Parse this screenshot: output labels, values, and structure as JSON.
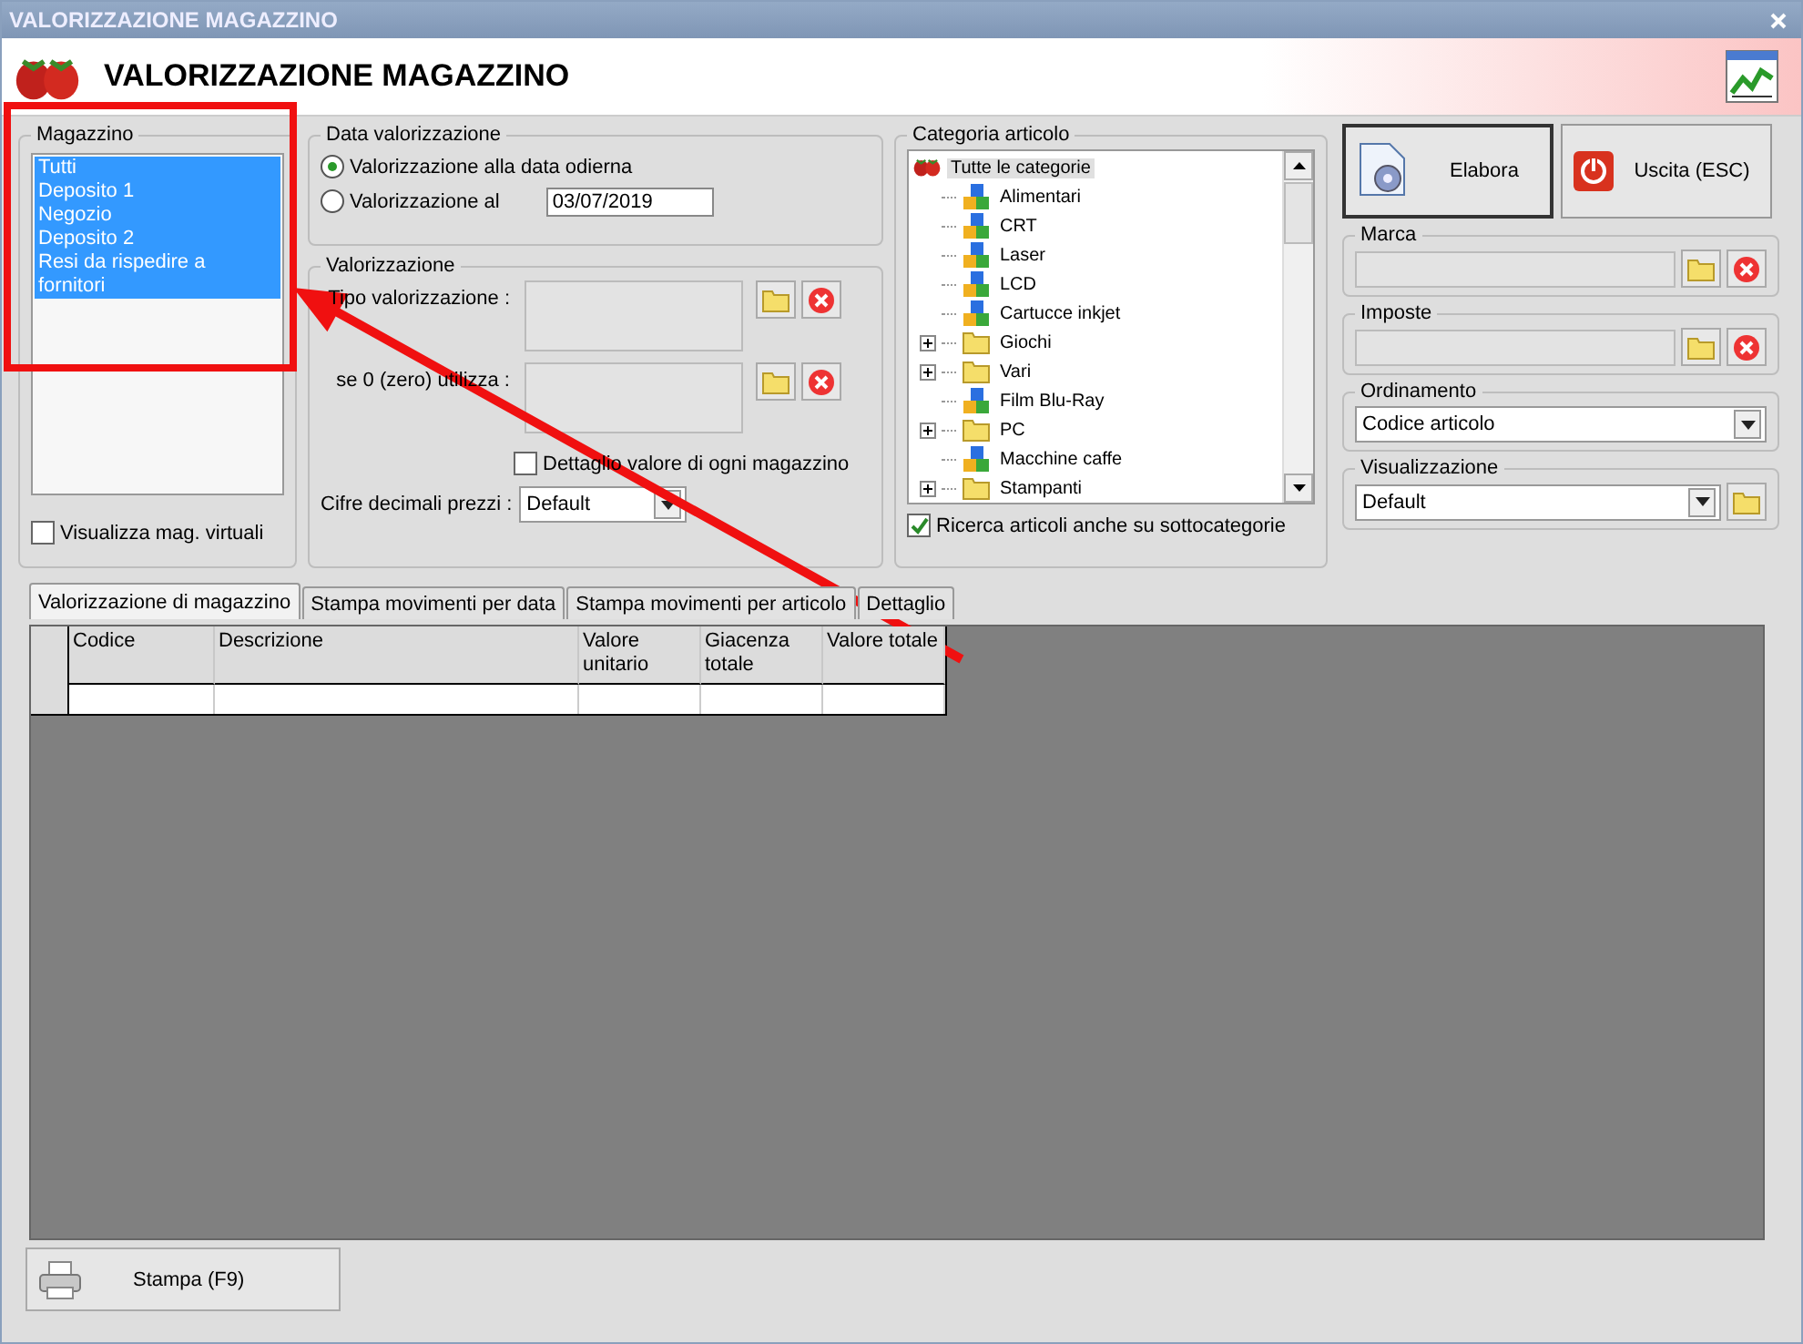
{
  "window": {
    "title": "VALORIZZAZIONE MAGAZZINO"
  },
  "header": {
    "title": "VALORIZZAZIONE MAGAZZINO"
  },
  "magazzino": {
    "label": "Magazzino",
    "items": [
      {
        "label": "Tutti",
        "selected": true
      },
      {
        "label": "Deposito 1",
        "selected": true
      },
      {
        "label": "Negozio",
        "selected": true
      },
      {
        "label": "Deposito 2",
        "selected": true
      },
      {
        "label": "Resi da rispedire a fornitori",
        "selected": true
      }
    ],
    "virtual": {
      "label": "Visualizza mag. virtuali",
      "checked": false
    }
  },
  "data_valorizzazione": {
    "label": "Data valorizzazione",
    "options": [
      {
        "label": "Valorizzazione alla data odierna",
        "selected": true
      },
      {
        "label": "Valorizzazione al",
        "selected": false
      }
    ],
    "date": "03/07/2019"
  },
  "valorizzazione": {
    "label": "Valorizzazione",
    "tipo_label": "Tipo valorizzazione :",
    "zero_label": "se 0 (zero) utilizza :",
    "dettaglio": {
      "label": "Dettaglio valore di ogni magazzino",
      "checked": false
    },
    "decimali_label": "Cifre decimali prezzi :",
    "decimali_value": "Default"
  },
  "categoria": {
    "label": "Categoria articolo",
    "root": {
      "label": "Tutte le categorie",
      "selected": true,
      "children": [
        {
          "label": "Alimentari",
          "kind": "category",
          "expandable": false
        },
        {
          "label": "CRT",
          "kind": "category",
          "expandable": false
        },
        {
          "label": "Laser",
          "kind": "category",
          "expandable": false
        },
        {
          "label": "LCD",
          "kind": "category",
          "expandable": false
        },
        {
          "label": "Cartucce inkjet",
          "kind": "category",
          "expandable": false
        },
        {
          "label": "Giochi",
          "kind": "folder",
          "expandable": true
        },
        {
          "label": "Vari",
          "kind": "folder",
          "expandable": true
        },
        {
          "label": "Film Blu-Ray",
          "kind": "category",
          "expandable": false
        },
        {
          "label": "PC",
          "kind": "folder",
          "expandable": true
        },
        {
          "label": "Macchine caffe",
          "kind": "category",
          "expandable": false
        },
        {
          "label": "Stampanti",
          "kind": "folder",
          "expandable": true
        }
      ]
    },
    "subcat": {
      "label": "Ricerca articoli anche su sottocategorie",
      "checked": true
    }
  },
  "buttons": [
    {
      "label": "Elabora",
      "kind": "process"
    },
    {
      "label": "Uscita (ESC)",
      "kind": "exit"
    }
  ],
  "marca": {
    "label": "Marca"
  },
  "imposte": {
    "label": "Imposte"
  },
  "ordinamento": {
    "label": "Ordinamento",
    "value": "Codice articolo"
  },
  "visualizzazione": {
    "label": "Visualizzazione",
    "value": "Default"
  },
  "tabs": [
    {
      "label": "Valorizzazione di magazzino",
      "selected": true
    },
    {
      "label": "Stampa movimenti per data",
      "selected": false
    },
    {
      "label": "Stampa movimenti per articolo",
      "selected": false
    },
    {
      "label": "Dettaglio",
      "selected": false
    }
  ],
  "table": {
    "columns": [
      "Codice",
      "Descrizione",
      "Valore unitario",
      "Giacenza totale",
      "Valore totale"
    ]
  },
  "print_button": {
    "label": "Stampa (F9)"
  }
}
